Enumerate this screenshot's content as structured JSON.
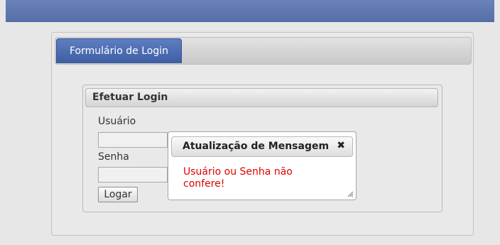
{
  "tabs": [
    {
      "label": "Formulário de Login"
    }
  ],
  "login": {
    "legend": "Efetuar Login",
    "user_label": "Usuário",
    "user_value": "",
    "pass_label": "Senha",
    "pass_value": "",
    "submit_label": "Logar"
  },
  "dialog": {
    "title": "Atualização de Mensagem",
    "close_glyph": "✖",
    "message": "Usuário ou Senha não confere!",
    "message_color": "#e00000"
  },
  "colors": {
    "header_bar": "#5670a8",
    "active_tab": "#4a6aad"
  }
}
